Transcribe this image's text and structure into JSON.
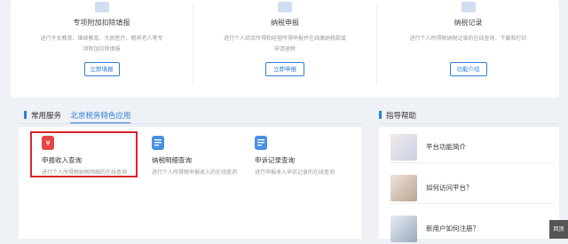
{
  "top_services": [
    {
      "title": "专项附加扣除填报",
      "desc": "进行子女教育、继续教育、大病医疗、赡养老人等专项附加扣除填报",
      "button": "立即填报"
    },
    {
      "title": "纳税申报",
      "desc": "进行个人综合所得和经营所得申报并在线缴纳税款或申请退税",
      "button": "立即申报"
    },
    {
      "title": "纳税记录",
      "desc": "进行个人所得税纳税记录的在线查询、下载和打印",
      "button": "功能介绍"
    }
  ],
  "section": {
    "common_label": "常用服务",
    "beijing_tab": "北京税务特色应用",
    "help_label": "指导帮助"
  },
  "common_services": [
    {
      "name": "申报收入查询",
      "sub": "进行个人所得税纳税明细的在线查询",
      "icon": "yuan-shield-icon",
      "color": "#e5464a"
    },
    {
      "name": "纳税明细查询",
      "sub": "进行个人所得税申报收入的在线查询",
      "icon": "document-icon",
      "color": "#4a90e2"
    },
    {
      "name": "申诉记录查询",
      "sub": "进行申报收入申诉记录的在线查询",
      "icon": "document-icon",
      "color": "#4a90e2"
    }
  ],
  "help": [
    {
      "label": "平台功能简介",
      "icon": "hand-pen-thumbnail"
    },
    {
      "label": "如何访问平台？",
      "icon": "hand-keyboard-thumbnail"
    },
    {
      "label": "新用户如何注册？",
      "icon": "book-thumbnail"
    }
  ],
  "float_button": "回顶"
}
